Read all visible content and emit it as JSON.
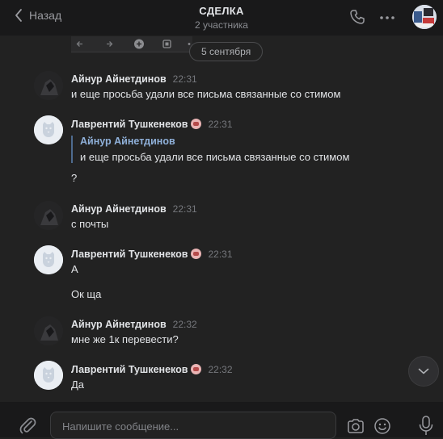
{
  "header": {
    "back_label": "Назад",
    "title": "СДЕЛКА",
    "subtitle": "2 участника"
  },
  "chat": {
    "date_label": "5 сентября",
    "messages": [
      {
        "author": "Айнур Айнетдинов",
        "time": "22:31",
        "lines": [
          "и еще просьба удали все письма связанные со стимом"
        ],
        "avatar": "dark-avatar"
      },
      {
        "author": "Лаврентий Тушкенеков",
        "time": "22:31",
        "quote_author": "Айнур Айнетдинов",
        "quote_text": "и еще просьба удали все письма связанные со стимом",
        "lines": [
          "?"
        ],
        "avatar": "vk-dog-avatar"
      },
      {
        "author": "Айнур Айнетдинов",
        "time": "22:31",
        "lines": [
          "с почты"
        ],
        "avatar": "dark-avatar"
      },
      {
        "author": "Лаврентий Тушкенеков",
        "time": "22:31",
        "lines": [
          "А",
          "Ок ща"
        ],
        "avatar": "vk-dog-avatar"
      },
      {
        "author": "Айнур Айнетдинов",
        "time": "22:32",
        "lines": [
          "мне же 1к перевести?"
        ],
        "avatar": "dark-avatar"
      },
      {
        "author": "Лаврентий Тушкенеков",
        "time": "22:32",
        "lines": [
          "Да"
        ],
        "avatar": "vk-dog-avatar"
      }
    ]
  },
  "composer": {
    "placeholder": "Напишите сообщение..."
  },
  "colors": {
    "background": "#222222",
    "header": "#19191a",
    "text": "#e1e3e6",
    "muted": "#76787d",
    "quote_author": "#8fb0d9"
  },
  "icons": [
    "chevron-left-icon",
    "phone-icon",
    "more-dots-icon",
    "paperclip-icon",
    "camera-icon",
    "smile-icon",
    "microphone-icon",
    "chevron-down-icon"
  ]
}
